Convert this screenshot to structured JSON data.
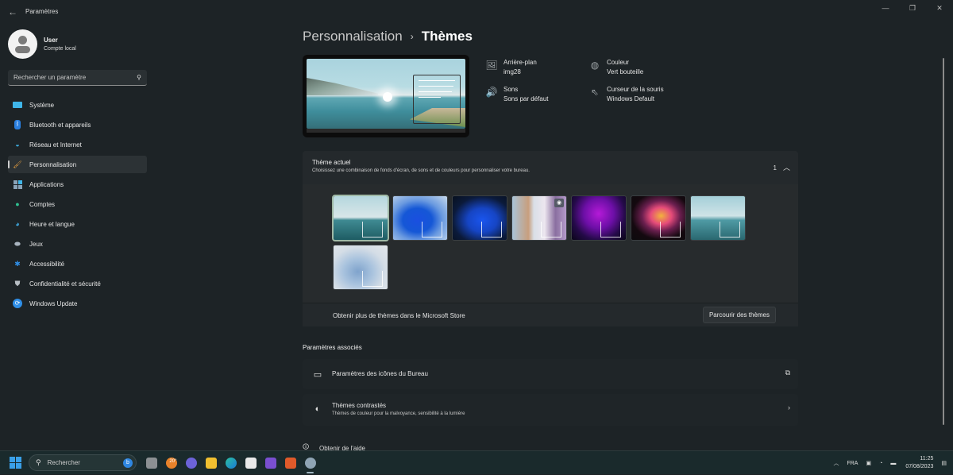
{
  "window": {
    "app_title": "Paramètres",
    "controls": {
      "minimize": "—",
      "maximize": "❐",
      "close": "✕"
    }
  },
  "user": {
    "name": "User",
    "account_type": "Compte local"
  },
  "search": {
    "placeholder": "Rechercher un paramètre"
  },
  "sidebar": {
    "items": [
      {
        "label": "Système",
        "icon": "system-icon",
        "active": false
      },
      {
        "label": "Bluetooth et appareils",
        "icon": "bluetooth-icon",
        "active": false
      },
      {
        "label": "Réseau et Internet",
        "icon": "wifi-icon",
        "active": false
      },
      {
        "label": "Personnalisation",
        "icon": "brush-icon",
        "active": true
      },
      {
        "label": "Applications",
        "icon": "apps-icon",
        "active": false
      },
      {
        "label": "Comptes",
        "icon": "account-icon",
        "active": false
      },
      {
        "label": "Heure et langue",
        "icon": "clock-globe-icon",
        "active": false
      },
      {
        "label": "Jeux",
        "icon": "gamepad-icon",
        "active": false
      },
      {
        "label": "Accessibilité",
        "icon": "accessibility-icon",
        "active": false
      },
      {
        "label": "Confidentialité et sécurité",
        "icon": "shield-icon",
        "active": false
      },
      {
        "label": "Windows Update",
        "icon": "update-icon",
        "active": false
      }
    ]
  },
  "breadcrumb": {
    "parent": "Personnalisation",
    "separator": "›",
    "current": "Thèmes"
  },
  "theme_properties": {
    "background": {
      "title": "Arrière-plan",
      "value": "img28"
    },
    "color": {
      "title": "Couleur",
      "value": "Vert bouteille"
    },
    "sounds": {
      "title": "Sons",
      "value": "Sons par défaut"
    },
    "cursor": {
      "title": "Curseur de la souris",
      "value": "Windows Default"
    }
  },
  "current_theme": {
    "title": "Thème actuel",
    "description": "Choisissez une combinaison de fonds d'écran, de sons et de couleurs pour personnaliser votre bureau.",
    "count": "1",
    "themes": [
      {
        "name": "lake-theme",
        "style": "t-lake",
        "selected": true
      },
      {
        "name": "bloom-light-theme",
        "style": "t-bloom-light",
        "selected": false
      },
      {
        "name": "bloom-dark-theme",
        "style": "t-bloom-dark",
        "selected": false
      },
      {
        "name": "spotlight-theme",
        "style": "t-spotlight",
        "selected": false
      },
      {
        "name": "glow-theme",
        "style": "t-glow",
        "selected": false
      },
      {
        "name": "flower-theme",
        "style": "t-flower",
        "selected": false
      },
      {
        "name": "lake-alt-theme",
        "style": "t-lake2",
        "selected": false
      },
      {
        "name": "ribbon-theme",
        "style": "t-ribbon",
        "selected": false
      }
    ],
    "store_text": "Obtenir plus de thèmes dans le Microsoft Store",
    "browse_button": "Parcourir des thèmes"
  },
  "related": {
    "title": "Paramètres associés",
    "items": [
      {
        "title": "Paramètres des icônes du Bureau",
        "subtitle": ""
      },
      {
        "title": "Thèmes contrastés",
        "subtitle": "Thèmes de couleur pour la malvoyance, sensibilité à la lumière"
      }
    ]
  },
  "help": {
    "label": "Obtenir de l'aide"
  },
  "taskbar": {
    "search_label": "Rechercher",
    "weather_temp": "20°",
    "tray": {
      "language": "FRA",
      "time": "11:25",
      "date": "07/08/2023"
    }
  },
  "colors": {
    "accent": "#3aa0e8",
    "selected_outline": "#9fb9a6",
    "background": "#1d2326"
  }
}
